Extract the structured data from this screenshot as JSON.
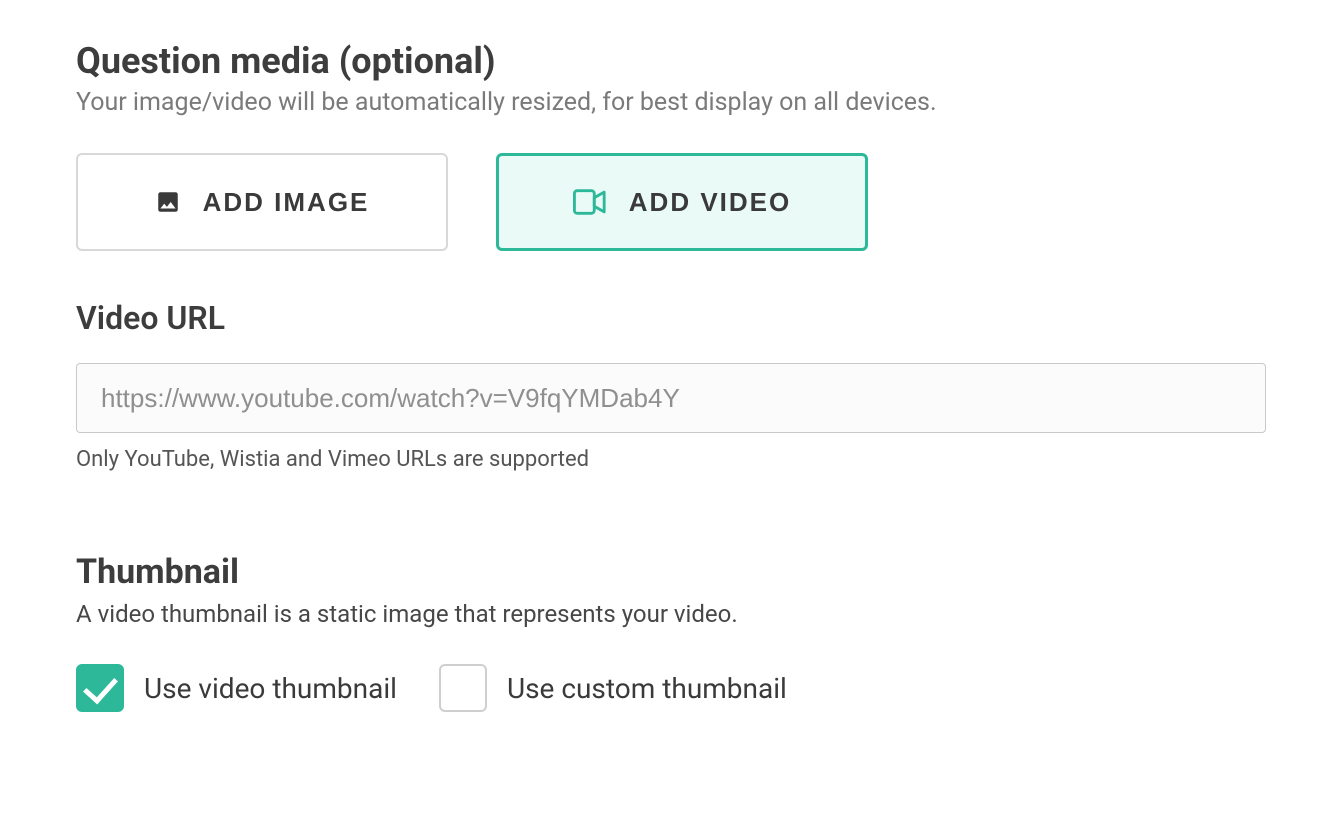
{
  "header": {
    "title": "Question media (optional)",
    "subtitle": "Your image/video will be automatically resized, for best display on all devices."
  },
  "buttons": {
    "add_image": "ADD IMAGE",
    "add_video": "ADD VIDEO"
  },
  "video_url": {
    "label": "Video URL",
    "placeholder": "https://www.youtube.com/watch?v=V9fqYMDab4Y",
    "helper": "Only YouTube, Wistia and Vimeo URLs are supported"
  },
  "thumbnail": {
    "title": "Thumbnail",
    "description": "A video thumbnail is a static image that represents your video.",
    "use_video": "Use video thumbnail",
    "use_custom": "Use custom thumbnail"
  }
}
